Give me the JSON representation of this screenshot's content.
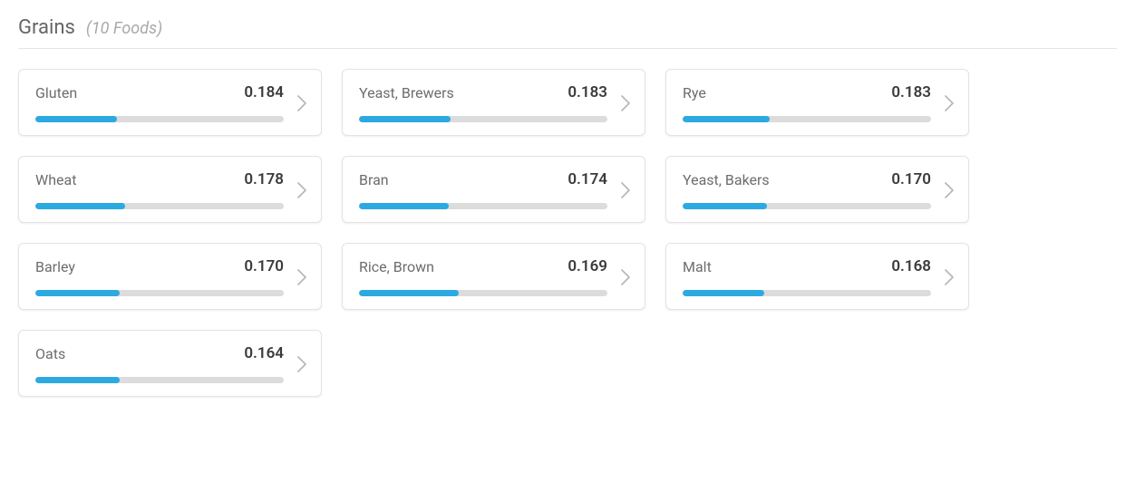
{
  "section": {
    "title": "Grains",
    "count_label": "(10 Foods)"
  },
  "foods": [
    {
      "name": "Gluten",
      "value": "0.184",
      "progress": 33
    },
    {
      "name": "Yeast, Brewers",
      "value": "0.183",
      "progress": 37
    },
    {
      "name": "Rye",
      "value": "0.183",
      "progress": 35
    },
    {
      "name": "Wheat",
      "value": "0.178",
      "progress": 36
    },
    {
      "name": "Bran",
      "value": "0.174",
      "progress": 36
    },
    {
      "name": "Yeast, Bakers",
      "value": "0.170",
      "progress": 34
    },
    {
      "name": "Barley",
      "value": "0.170",
      "progress": 34
    },
    {
      "name": "Rice, Brown",
      "value": "0.169",
      "progress": 40
    },
    {
      "name": "Malt",
      "value": "0.168",
      "progress": 33
    },
    {
      "name": "Oats",
      "value": "0.164",
      "progress": 34
    }
  ]
}
